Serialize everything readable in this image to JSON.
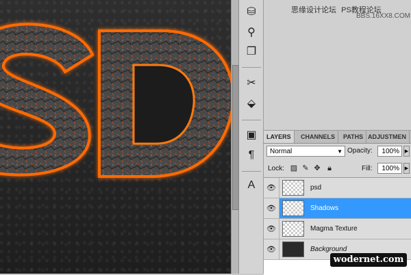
{
  "watermark": {
    "top_text": "思缘设计论坛",
    "sub_text": "PS教程论坛",
    "site": "BBS.16XX8.COM"
  },
  "canvas": {
    "letters": [
      "S",
      "D"
    ]
  },
  "dock": {
    "tools": [
      {
        "icon": "brush-preset-icon",
        "glyph": "⛁"
      },
      {
        "icon": "clone-source-icon",
        "glyph": "⚲"
      },
      {
        "icon": "layer-comps-icon",
        "glyph": "❐"
      },
      {
        "icon": "tools-preset-icon",
        "glyph": "✂"
      },
      {
        "icon": "bucket-icon",
        "glyph": "⬙"
      },
      {
        "icon": "navigator-icon",
        "glyph": "▣"
      },
      {
        "icon": "paragraph-icon",
        "glyph": "¶"
      },
      {
        "icon": "character-icon",
        "glyph": "A"
      }
    ]
  },
  "layers_panel": {
    "tabs": [
      "LAYERS",
      "CHANNELS",
      "PATHS",
      "ADJUSTMEN"
    ],
    "blend_mode": "Normal",
    "opacity_label": "Opacity:",
    "opacity_value": "100%",
    "lock_label": "Lock:",
    "fill_label": "Fill:",
    "fill_value": "100%",
    "layers": [
      {
        "name": "psd",
        "selected": false,
        "italic": false
      },
      {
        "name": "Shadows",
        "selected": true,
        "italic": false
      },
      {
        "name": "Magma Texture",
        "selected": false,
        "italic": false
      },
      {
        "name": "Background",
        "selected": false,
        "italic": true
      }
    ]
  },
  "footer_watermark": "wodernet.com",
  "colors": {
    "selection": "#3399ff",
    "lava": "#ff6a00",
    "canvas_bg": "#242424"
  }
}
